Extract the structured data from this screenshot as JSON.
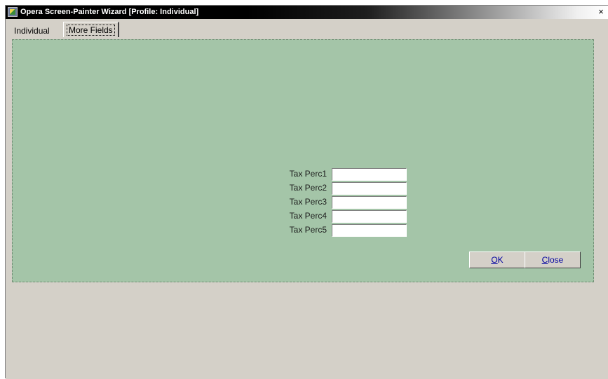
{
  "window": {
    "title": "Opera Screen-Painter Wizard [Profile: Individual]",
    "icon": "app-icon",
    "close_glyph": "×"
  },
  "tabs": [
    {
      "label": "Individual",
      "active": false
    },
    {
      "label": "More Fields",
      "active": true
    }
  ],
  "fields": [
    {
      "label": "Tax Perc1",
      "value": ""
    },
    {
      "label": "Tax Perc2",
      "value": ""
    },
    {
      "label": "Tax Perc3",
      "value": ""
    },
    {
      "label": "Tax Perc4",
      "value": ""
    },
    {
      "label": "Tax Perc5",
      "value": ""
    }
  ],
  "buttons": {
    "ok_mnemonic": "O",
    "ok_rest": "K",
    "close_mnemonic": "C",
    "close_rest": "lose"
  },
  "colors": {
    "panel_bg": "#a4c5a8",
    "window_bg": "#d4d0c8",
    "button_text": "#0000a0"
  }
}
